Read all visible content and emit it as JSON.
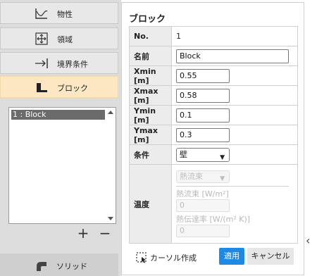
{
  "sidebar": {
    "items": [
      {
        "label": "物性",
        "icon": "material-graph-icon"
      },
      {
        "label": "領域",
        "icon": "move-arrows-icon"
      },
      {
        "label": "境界条件",
        "icon": "arrow-to-wall-icon"
      },
      {
        "label": "ブロック",
        "icon": "block-icon"
      }
    ],
    "list": {
      "items": [
        "1 : Block"
      ]
    },
    "add_label": "+",
    "remove_label": "−",
    "solid": {
      "label": "ソリッド",
      "icon": "pipe-bend-icon"
    }
  },
  "panel": {
    "title": "ブロック",
    "rows": {
      "no": {
        "key": "No.",
        "value": "1"
      },
      "name": {
        "key": "名前",
        "value": "Block"
      },
      "xmin": {
        "key": "Xmin [m]",
        "value": "0.55"
      },
      "xmax": {
        "key": "Xmax [m]",
        "value": "0.58"
      },
      "ymin": {
        "key": "Ymin [m]",
        "value": "0.1"
      },
      "ymax": {
        "key": "Ymax [m]",
        "value": "0.3"
      },
      "condition": {
        "key": "条件",
        "value": "壁"
      },
      "temperature": {
        "key": "温度",
        "type_value": "熱流束",
        "heat_flux_label": "熱流束 [W/m²]",
        "heat_flux_value": "0",
        "htc_label": "熱伝達率 [W/(m² K)]",
        "htc_value": "0"
      }
    },
    "cursor_create_label": "カーソル作成",
    "apply_label": "適用",
    "cancel_label": "キャンセル"
  },
  "colors": {
    "accent": "#1e88e5",
    "active_nav": "#fde7c2"
  }
}
